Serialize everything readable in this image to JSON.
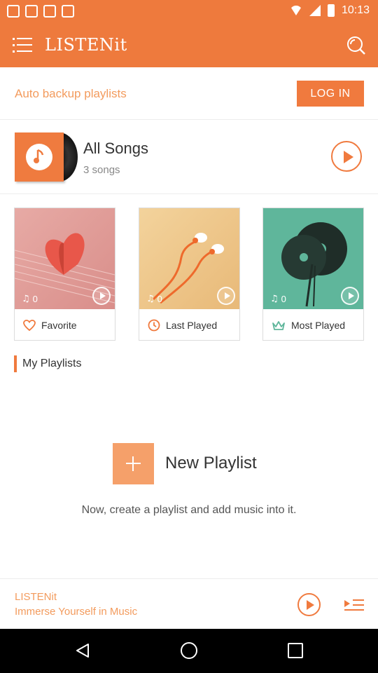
{
  "status_bar": {
    "time": "10:13"
  },
  "app_bar": {
    "title": "LISTENit",
    "menu_icon": "menu-icon",
    "search_icon": "search-icon"
  },
  "backup": {
    "text": "Auto backup playlists",
    "login_label": "LOG IN"
  },
  "all_songs": {
    "title": "All Songs",
    "count": "3 songs"
  },
  "cards": [
    {
      "label": "Favorite",
      "count": "0",
      "icon": "heart-icon"
    },
    {
      "label": "Last Played",
      "count": "0",
      "icon": "clock-icon"
    },
    {
      "label": "Most Played",
      "count": "0",
      "icon": "crown-icon"
    }
  ],
  "my_playlists": {
    "title": "My Playlists"
  },
  "new_playlist": {
    "title": "New Playlist",
    "description": "Now, create a playlist and add music into it."
  },
  "player": {
    "title": "LISTENit",
    "subtitle": "Immerse Yourself in Music"
  },
  "colors": {
    "accent": "#ee7a3d",
    "accent_light": "#f5a06a",
    "text_accent": "#f39b5d"
  }
}
